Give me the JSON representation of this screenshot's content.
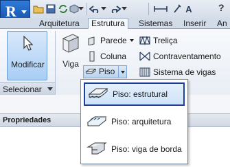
{
  "app": {
    "button_letter": "R"
  },
  "quick_access": {
    "icons": [
      "open-folder-icon",
      "save-icon",
      "sync-icon",
      "cube-icon",
      "undo-icon",
      "undo-dropdown-icon",
      "redo-icon",
      "measure-icon",
      "pin-icon",
      "text-icon"
    ],
    "help_label": "?"
  },
  "tabs": [
    {
      "label": "Arquitetura"
    },
    {
      "label": "Estrutura"
    },
    {
      "label": "Sistemas"
    },
    {
      "label": "Inserir"
    },
    {
      "label": "An"
    }
  ],
  "active_tab": "Estrutura",
  "ribbon": {
    "modify_label": "Modificar",
    "select_label": "Selecionar",
    "viga_label": "Viga",
    "col1": {
      "parede": "Parede",
      "coluna": "Coluna",
      "piso": "Piso"
    },
    "col2": {
      "trelica": "Treliça",
      "contraventamento": "Contraventamento",
      "sistema_vigas": "Sistema de vigas"
    }
  },
  "properties_label": "Propriedades",
  "floor_menu": {
    "items": [
      {
        "label": "Piso: estrutural",
        "selected": true
      },
      {
        "label": "Piso: arquitetura",
        "selected": false
      },
      {
        "label": "Piso: viga de borda",
        "selected": false
      }
    ]
  },
  "colors": {
    "accent": "#1e3f9a",
    "app_button": "#1a5fc2",
    "highlight": "#cfe3f8"
  }
}
